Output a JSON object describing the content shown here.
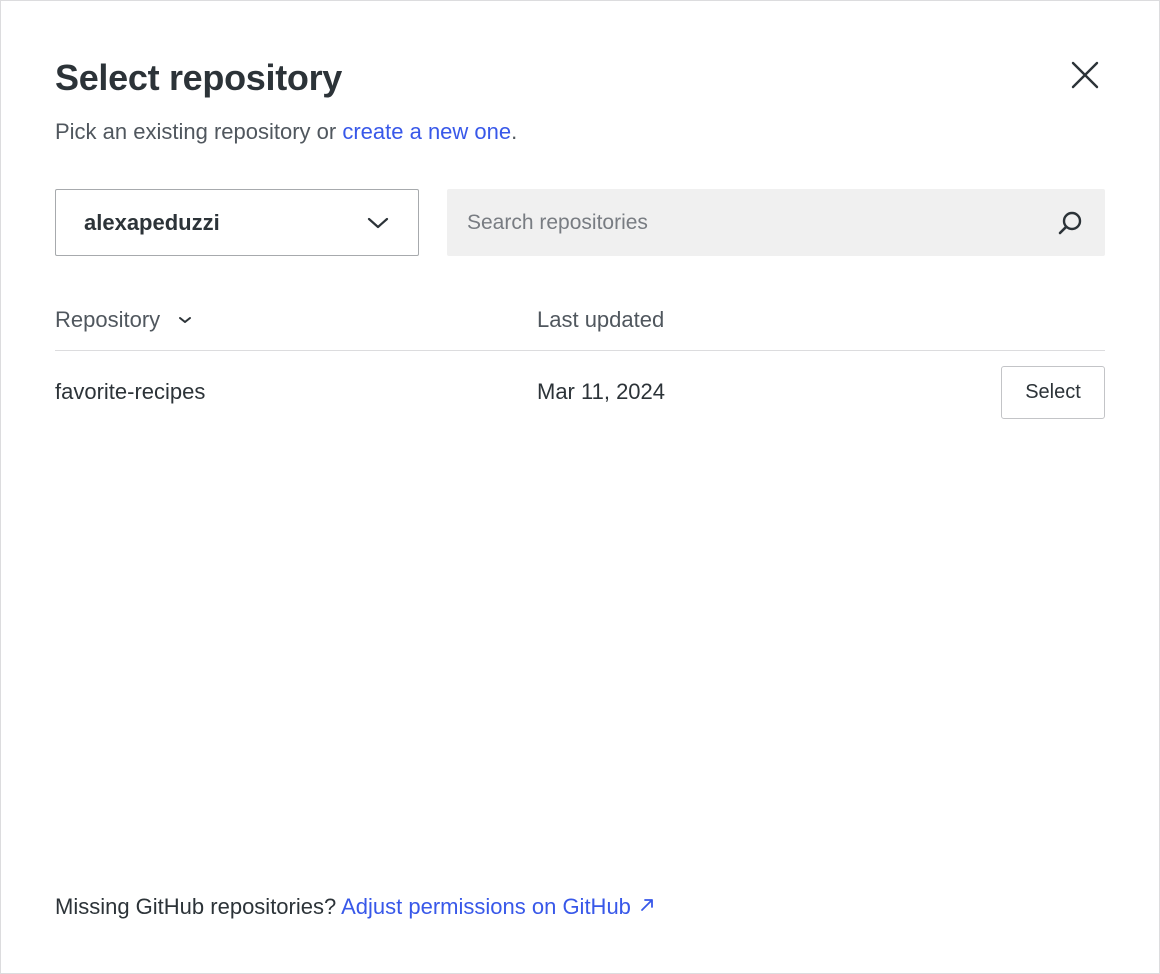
{
  "dialog": {
    "title": "Select repository",
    "subtitle_prefix": "Pick an existing repository or ",
    "subtitle_link": "create a new one",
    "subtitle_suffix": ".",
    "close_icon": "close-icon"
  },
  "account_select": {
    "value": "alexapeduzzi",
    "icon": "chevron-down-icon"
  },
  "search": {
    "placeholder": "Search repositories",
    "value": "",
    "icon": "search-icon"
  },
  "table": {
    "columns": {
      "repository": "Repository",
      "last_updated": "Last updated"
    },
    "sort_icon": "chevron-down-icon",
    "rows": [
      {
        "name": "favorite-recipes",
        "updated": "Mar 11, 2024",
        "action_label": "Select"
      }
    ]
  },
  "footer": {
    "text": "Missing GitHub repositories? ",
    "link": "Adjust permissions on GitHub",
    "link_icon": "external-link-icon"
  },
  "colors": {
    "link": "#3858e9",
    "text": "#2c3338",
    "muted": "#50575e",
    "border": "#dcdcde",
    "search_bg": "#f0f0f0"
  }
}
